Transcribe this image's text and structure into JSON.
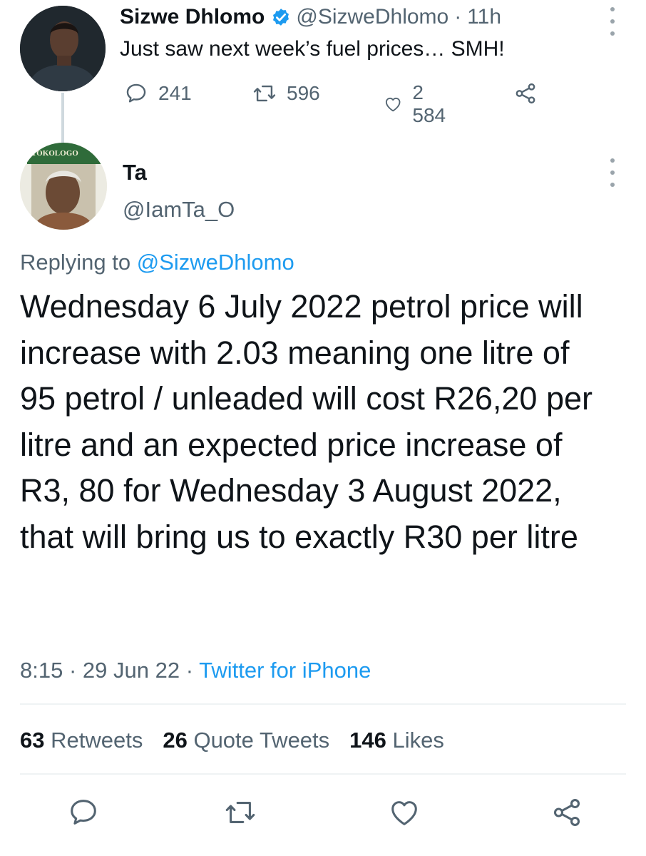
{
  "parent_tweet": {
    "name": "Sizwe Dhlomo",
    "handle": "@SizweDhlomo",
    "separator": "·",
    "time": "11h",
    "text": "Just saw next week’s fuel prices… SMH!",
    "replies": "241",
    "retweets": "596",
    "likes": "2 584",
    "verified_color": "#1d9bf0"
  },
  "main_tweet": {
    "name": "Ta",
    "handle": "@IamTa_O",
    "replying_prefix": "Replying to",
    "replying_to": "@SizweDhlomo",
    "text": "Wednesday 6 July 2022 petrol price will increase with 2.03 meaning one litre of 95 petrol / unleaded will cost R26,20 per litre and an expected price increase of R3, 80 for Wednesday 3 August 2022, that will bring us to exactly R30 per litre",
    "time": "8:15",
    "date": "29 Jun 22",
    "separator": "·",
    "source": "Twitter for iPhone",
    "avatar_book_text": "TOKOLOGO"
  },
  "stats": {
    "retweets_count": "63",
    "retweets_label": "Retweets",
    "quotes_count": "26",
    "quotes_label": "Quote Tweets",
    "likes_count": "146",
    "likes_label": "Likes"
  },
  "colors": {
    "accent": "#1d9bf0",
    "secondary_text": "#536471",
    "primary_text": "#0f1419",
    "divider": "#eff3f4"
  },
  "icons": {
    "reply": "reply-icon",
    "retweet": "retweet-icon",
    "like": "heart-icon",
    "share": "share-icon",
    "more": "more-options-icon",
    "verified": "verified-badge-icon"
  }
}
